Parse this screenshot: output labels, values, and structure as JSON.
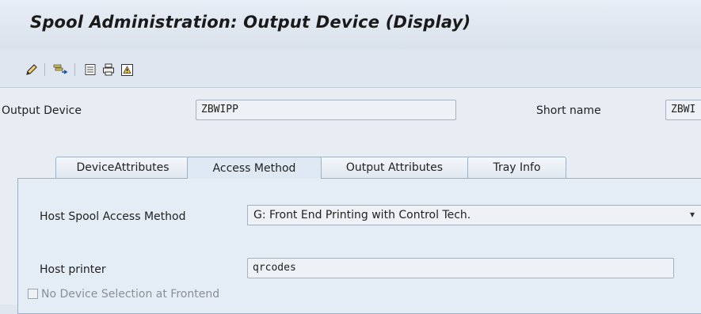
{
  "header": {
    "title": "Spool Administration: Output Device (Display)"
  },
  "toolbar": {
    "icons": [
      "pencil-icon",
      "object-transport-icon",
      "list-icon",
      "printer-icon",
      "warning-icon"
    ]
  },
  "form": {
    "output_device_label": "Output Device",
    "output_device_value": "ZBWIPP",
    "short_name_label": "Short name",
    "short_name_value": "ZBWI"
  },
  "tabs": [
    {
      "label": "DeviceAttributes",
      "active": false
    },
    {
      "label": "Access Method",
      "active": true
    },
    {
      "label": "Output Attributes",
      "active": false
    },
    {
      "label": "Tray Info",
      "active": false
    }
  ],
  "access_method": {
    "host_spool_label": "Host Spool Access Method",
    "host_spool_value": "G: Front End Printing with Control Tech.",
    "host_printer_label": "Host printer",
    "host_printer_value": "qrcodes",
    "no_device_selection_label": "No Device Selection at Frontend",
    "no_device_selection_checked": false
  },
  "colors": {
    "background": "#dfe6ef",
    "tab_active": "#dfe9f4"
  }
}
